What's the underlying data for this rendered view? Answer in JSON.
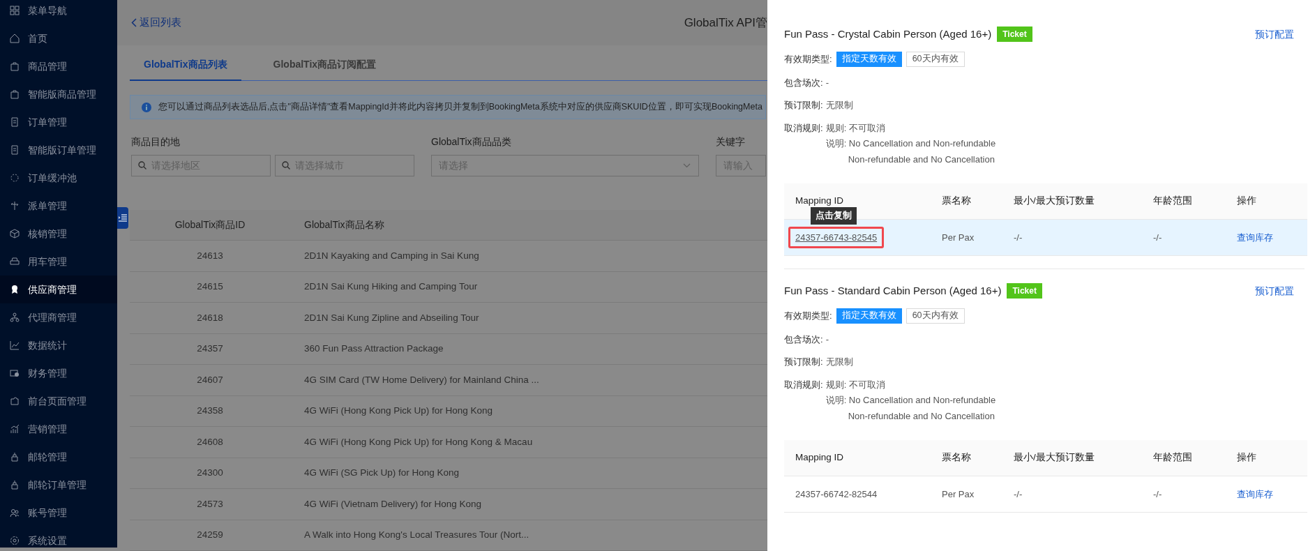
{
  "sidebar": {
    "items": [
      {
        "label": "菜单导航",
        "selected": false
      },
      {
        "label": "首页",
        "selected": false
      },
      {
        "label": "商品管理",
        "selected": false
      },
      {
        "label": "智能版商品管理",
        "selected": false
      },
      {
        "label": "订单管理",
        "selected": false
      },
      {
        "label": "智能版订单管理",
        "selected": false
      },
      {
        "label": "订单缓冲池",
        "selected": false
      },
      {
        "label": "派单管理",
        "selected": false
      },
      {
        "label": "核销管理",
        "selected": false
      },
      {
        "label": "用车管理",
        "selected": false
      },
      {
        "label": "供应商管理",
        "selected": true
      },
      {
        "label": "代理商管理",
        "selected": false
      },
      {
        "label": "数据统计",
        "selected": false
      },
      {
        "label": "财务管理",
        "selected": false
      },
      {
        "label": "前台页面管理",
        "selected": false
      },
      {
        "label": "营销管理",
        "selected": false
      },
      {
        "label": "邮轮管理",
        "selected": false
      },
      {
        "label": "邮轮订单管理",
        "selected": false
      },
      {
        "label": "账号管理",
        "selected": false
      },
      {
        "label": "系统设置",
        "selected": false
      }
    ]
  },
  "header": {
    "back_link": "返回列表",
    "title": "GlobalTix API管"
  },
  "tabs": [
    {
      "label": "GlobalTix商品列表",
      "selected": true
    },
    {
      "label": "GlobalTix商品订阅配置",
      "selected": false
    }
  ],
  "alert": "您可以通过商品列表选品后,点击\"商品详情\"查看MappingId并将此内容拷贝并复制到BookingMeta系统中对应的供应商SKUID位置，即可实现BookingMeta",
  "filters": [
    {
      "label": "商品目的地",
      "fields": [
        {
          "kind": "search",
          "placeholder": "请选择地区"
        },
        {
          "kind": "search",
          "placeholder": "请选择城市"
        }
      ]
    },
    {
      "label": "GlobalTix商品品类",
      "fields": [
        {
          "kind": "select",
          "placeholder": "请选择"
        }
      ]
    },
    {
      "label": "关键字",
      "fields": [
        {
          "kind": "text",
          "placeholder": "请输入"
        }
      ]
    }
  ],
  "table": {
    "columns": [
      "GlobalTix商品ID",
      "GlobalTix商品名称"
    ],
    "rows": [
      [
        "24613",
        "2D1N Kayaking and Camping in Sai Kung"
      ],
      [
        "24615",
        "2D1N Sai Kung Hiking and Camping Tour"
      ],
      [
        "24618",
        "2D1N Sai Kung Zipline and Abseiling Tour"
      ],
      [
        "24357",
        "360 Fun Pass Attraction Package"
      ],
      [
        "24607",
        "4G SIM Card (TW Home Delivery) for Mainland China ..."
      ],
      [
        "24358",
        "4G WiFi (Hong Kong Pick Up) for Hong Kong"
      ],
      [
        "24608",
        "4G WiFi (Hong Kong Pick Up) for Hong Kong & Macau"
      ],
      [
        "24300",
        "4G WiFi (SG Pick Up) for Hong Kong"
      ],
      [
        "24573",
        "4G WiFi (Vietnam Delivery) for Hong Kong"
      ],
      [
        "24259",
        "A Walk into Hong Kong's Local Treasures Tour (Nort..."
      ]
    ]
  },
  "drawer": {
    "sections": [
      {
        "title": "Fun Pass - Crystal Cabin Person (Aged 16+)",
        "tag": "Ticket",
        "link": "预订配置",
        "validity_label": "有效期类型:",
        "validity_tags": [
          {
            "text": "指定天数有效",
            "kind": "primary"
          },
          {
            "text": "60天内有效",
            "kind": "plain"
          }
        ],
        "sessions_label": "包含场次:",
        "sessions": "-",
        "limit_label": "预订限制:",
        "limit": "无限制",
        "cancel_label": "取消规则:",
        "cancel_lines": [
          "规则: 不可取消",
          "说明: No Cancellation and Non-refundable",
          "Non-refundable and No Cancellation"
        ],
        "columns": [
          "Mapping ID",
          "票名称",
          "最小/最大预订数量",
          "年龄范围",
          "操作"
        ],
        "rows": [
          {
            "mapping_id": "24357-66743-82545",
            "ticket_name": "Per Pax",
            "min_max": "-/-",
            "age_range": "-/-",
            "action": "查询库存",
            "selected": true,
            "outlined": true,
            "tooltip": "点击复制"
          }
        ]
      },
      {
        "title": "Fun Pass - Standard Cabin Person (Aged 16+)",
        "tag": "Ticket",
        "link": "预订配置",
        "validity_label": "有效期类型:",
        "validity_tags": [
          {
            "text": "指定天数有效",
            "kind": "primary"
          },
          {
            "text": "60天内有效",
            "kind": "plain"
          }
        ],
        "sessions_label": "包含场次:",
        "sessions": "-",
        "limit_label": "预订限制:",
        "limit": "无限制",
        "cancel_label": "取消规则:",
        "cancel_lines": [
          "规则: 不可取消",
          "说明: No Cancellation and Non-refundable",
          "Non-refundable and No Cancellation"
        ],
        "columns": [
          "Mapping ID",
          "票名称",
          "最小/最大预订数量",
          "年龄范围",
          "操作"
        ],
        "rows": [
          {
            "mapping_id": "24357-66742-82544",
            "ticket_name": "Per Pax",
            "min_max": "-/-",
            "age_range": "-/-",
            "action": "查询库存",
            "selected": false,
            "outlined": false
          }
        ]
      }
    ]
  }
}
